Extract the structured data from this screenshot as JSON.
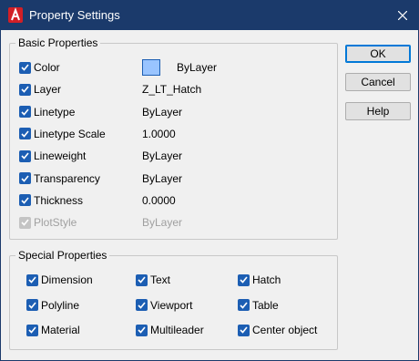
{
  "window": {
    "title": "Property Settings",
    "close_glyph": "✕",
    "app_icon": "autocad-logo-icon",
    "app_icon_color": "#d21f26",
    "titlebar_color": "#1b3a6b"
  },
  "basic": {
    "label": "Basic Properties",
    "rows": [
      {
        "label": "Color",
        "value": "ByLayer",
        "checked": true,
        "enabled": true,
        "swatch": "#99c4ff"
      },
      {
        "label": "Layer",
        "value": "Z_LT_Hatch",
        "checked": true,
        "enabled": true
      },
      {
        "label": "Linetype",
        "value": "ByLayer",
        "checked": true,
        "enabled": true
      },
      {
        "label": "Linetype Scale",
        "value": "1.0000",
        "checked": true,
        "enabled": true
      },
      {
        "label": "Lineweight",
        "value": "ByLayer",
        "checked": true,
        "enabled": true
      },
      {
        "label": "Transparency",
        "value": "ByLayer",
        "checked": true,
        "enabled": true
      },
      {
        "label": "Thickness",
        "value": "0.0000",
        "checked": true,
        "enabled": true
      },
      {
        "label": "PlotStyle",
        "value": "ByLayer",
        "checked": true,
        "enabled": false
      }
    ]
  },
  "special": {
    "label": "Special Properties",
    "items": [
      {
        "label": "Dimension",
        "checked": true
      },
      {
        "label": "Text",
        "checked": true
      },
      {
        "label": "Hatch",
        "checked": true
      },
      {
        "label": "Polyline",
        "checked": true
      },
      {
        "label": "Viewport",
        "checked": true
      },
      {
        "label": "Table",
        "checked": true
      },
      {
        "label": "Material",
        "checked": true
      },
      {
        "label": "Multileader",
        "checked": true
      },
      {
        "label": "Center object",
        "checked": true
      }
    ]
  },
  "buttons": {
    "ok": "OK",
    "cancel": "Cancel",
    "help": "Help"
  },
  "accent_color": "#1c5eb3"
}
